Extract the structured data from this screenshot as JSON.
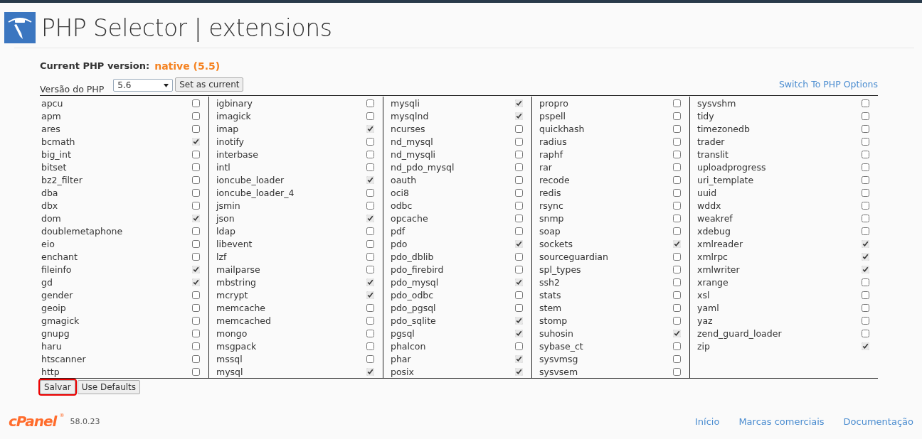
{
  "header": {
    "title": "PHP Selector | extensions"
  },
  "current_version": {
    "label": "Current PHP version:",
    "value": "native (5.5)"
  },
  "version_picker": {
    "label": "Versão do PHP",
    "value": "5.6",
    "button": "Set as current"
  },
  "switch_link": "Switch To PHP Options",
  "extension_columns": [
    [
      {
        "name": "apcu",
        "checked": false
      },
      {
        "name": "apm",
        "checked": false
      },
      {
        "name": "ares",
        "checked": false
      },
      {
        "name": "bcmath",
        "checked": true
      },
      {
        "name": "big_int",
        "checked": false
      },
      {
        "name": "bitset",
        "checked": false
      },
      {
        "name": "bz2_filter",
        "checked": false
      },
      {
        "name": "dba",
        "checked": false
      },
      {
        "name": "dbx",
        "checked": false
      },
      {
        "name": "dom",
        "checked": true
      },
      {
        "name": "doublemetaphone",
        "checked": false
      },
      {
        "name": "eio",
        "checked": false
      },
      {
        "name": "enchant",
        "checked": false
      },
      {
        "name": "fileinfo",
        "checked": true
      },
      {
        "name": "gd",
        "checked": true
      },
      {
        "name": "gender",
        "checked": false
      },
      {
        "name": "geoip",
        "checked": false
      },
      {
        "name": "gmagick",
        "checked": false
      },
      {
        "name": "gnupg",
        "checked": false
      },
      {
        "name": "haru",
        "checked": false
      },
      {
        "name": "htscanner",
        "checked": false
      },
      {
        "name": "http",
        "checked": false
      }
    ],
    [
      {
        "name": "igbinary",
        "checked": false
      },
      {
        "name": "imagick",
        "checked": false
      },
      {
        "name": "imap",
        "checked": true
      },
      {
        "name": "inotify",
        "checked": false
      },
      {
        "name": "interbase",
        "checked": false
      },
      {
        "name": "intl",
        "checked": false
      },
      {
        "name": "ioncube_loader",
        "checked": true
      },
      {
        "name": "ioncube_loader_4",
        "checked": false
      },
      {
        "name": "jsmin",
        "checked": false
      },
      {
        "name": "json",
        "checked": true
      },
      {
        "name": "ldap",
        "checked": false
      },
      {
        "name": "libevent",
        "checked": false
      },
      {
        "name": "lzf",
        "checked": false
      },
      {
        "name": "mailparse",
        "checked": false
      },
      {
        "name": "mbstring",
        "checked": true
      },
      {
        "name": "mcrypt",
        "checked": true
      },
      {
        "name": "memcache",
        "checked": false
      },
      {
        "name": "memcached",
        "checked": false
      },
      {
        "name": "mongo",
        "checked": false
      },
      {
        "name": "msgpack",
        "checked": false
      },
      {
        "name": "mssql",
        "checked": false
      },
      {
        "name": "mysql",
        "checked": true
      }
    ],
    [
      {
        "name": "mysqli",
        "checked": true
      },
      {
        "name": "mysqlnd",
        "checked": true
      },
      {
        "name": "ncurses",
        "checked": false
      },
      {
        "name": "nd_mysql",
        "checked": false
      },
      {
        "name": "nd_mysqli",
        "checked": false
      },
      {
        "name": "nd_pdo_mysql",
        "checked": false
      },
      {
        "name": "oauth",
        "checked": false
      },
      {
        "name": "oci8",
        "checked": false
      },
      {
        "name": "odbc",
        "checked": false
      },
      {
        "name": "opcache",
        "checked": false
      },
      {
        "name": "pdf",
        "checked": false
      },
      {
        "name": "pdo",
        "checked": true
      },
      {
        "name": "pdo_dblib",
        "checked": false
      },
      {
        "name": "pdo_firebird",
        "checked": false
      },
      {
        "name": "pdo_mysql",
        "checked": true
      },
      {
        "name": "pdo_odbc",
        "checked": false
      },
      {
        "name": "pdo_pgsql",
        "checked": false
      },
      {
        "name": "pdo_sqlite",
        "checked": true
      },
      {
        "name": "pgsql",
        "checked": true
      },
      {
        "name": "phalcon",
        "checked": false
      },
      {
        "name": "phar",
        "checked": true
      },
      {
        "name": "posix",
        "checked": true
      }
    ],
    [
      {
        "name": "propro",
        "checked": false
      },
      {
        "name": "pspell",
        "checked": false
      },
      {
        "name": "quickhash",
        "checked": false
      },
      {
        "name": "radius",
        "checked": false
      },
      {
        "name": "raphf",
        "checked": false
      },
      {
        "name": "rar",
        "checked": false
      },
      {
        "name": "recode",
        "checked": false
      },
      {
        "name": "redis",
        "checked": false
      },
      {
        "name": "rsync",
        "checked": false
      },
      {
        "name": "snmp",
        "checked": false
      },
      {
        "name": "soap",
        "checked": false
      },
      {
        "name": "sockets",
        "checked": true
      },
      {
        "name": "sourceguardian",
        "checked": false
      },
      {
        "name": "spl_types",
        "checked": false
      },
      {
        "name": "ssh2",
        "checked": false
      },
      {
        "name": "stats",
        "checked": false
      },
      {
        "name": "stem",
        "checked": false
      },
      {
        "name": "stomp",
        "checked": false
      },
      {
        "name": "suhosin",
        "checked": true
      },
      {
        "name": "sybase_ct",
        "checked": false
      },
      {
        "name": "sysvmsg",
        "checked": false
      },
      {
        "name": "sysvsem",
        "checked": false
      }
    ],
    [
      {
        "name": "sysvshm",
        "checked": false
      },
      {
        "name": "tidy",
        "checked": false
      },
      {
        "name": "timezonedb",
        "checked": false
      },
      {
        "name": "trader",
        "checked": false
      },
      {
        "name": "translit",
        "checked": false
      },
      {
        "name": "uploadprogress",
        "checked": false
      },
      {
        "name": "uri_template",
        "checked": false
      },
      {
        "name": "uuid",
        "checked": false
      },
      {
        "name": "wddx",
        "checked": false
      },
      {
        "name": "weakref",
        "checked": false
      },
      {
        "name": "xdebug",
        "checked": false
      },
      {
        "name": "xmlreader",
        "checked": true
      },
      {
        "name": "xmlrpc",
        "checked": true
      },
      {
        "name": "xmlwriter",
        "checked": true
      },
      {
        "name": "xrange",
        "checked": false
      },
      {
        "name": "xsl",
        "checked": false
      },
      {
        "name": "yaml",
        "checked": false
      },
      {
        "name": "yaz",
        "checked": false
      },
      {
        "name": "zend_guard_loader",
        "checked": false
      },
      {
        "name": "zip",
        "checked": true
      }
    ]
  ],
  "actions": [
    {
      "label": "Salvar",
      "highlighted": true
    },
    {
      "label": "Use Defaults",
      "highlighted": false
    }
  ],
  "footer": {
    "logo": "cPanel",
    "trademark": "®",
    "version": "58.0.23",
    "links": [
      "Início",
      "Marcas comerciais",
      "Documentação"
    ]
  }
}
